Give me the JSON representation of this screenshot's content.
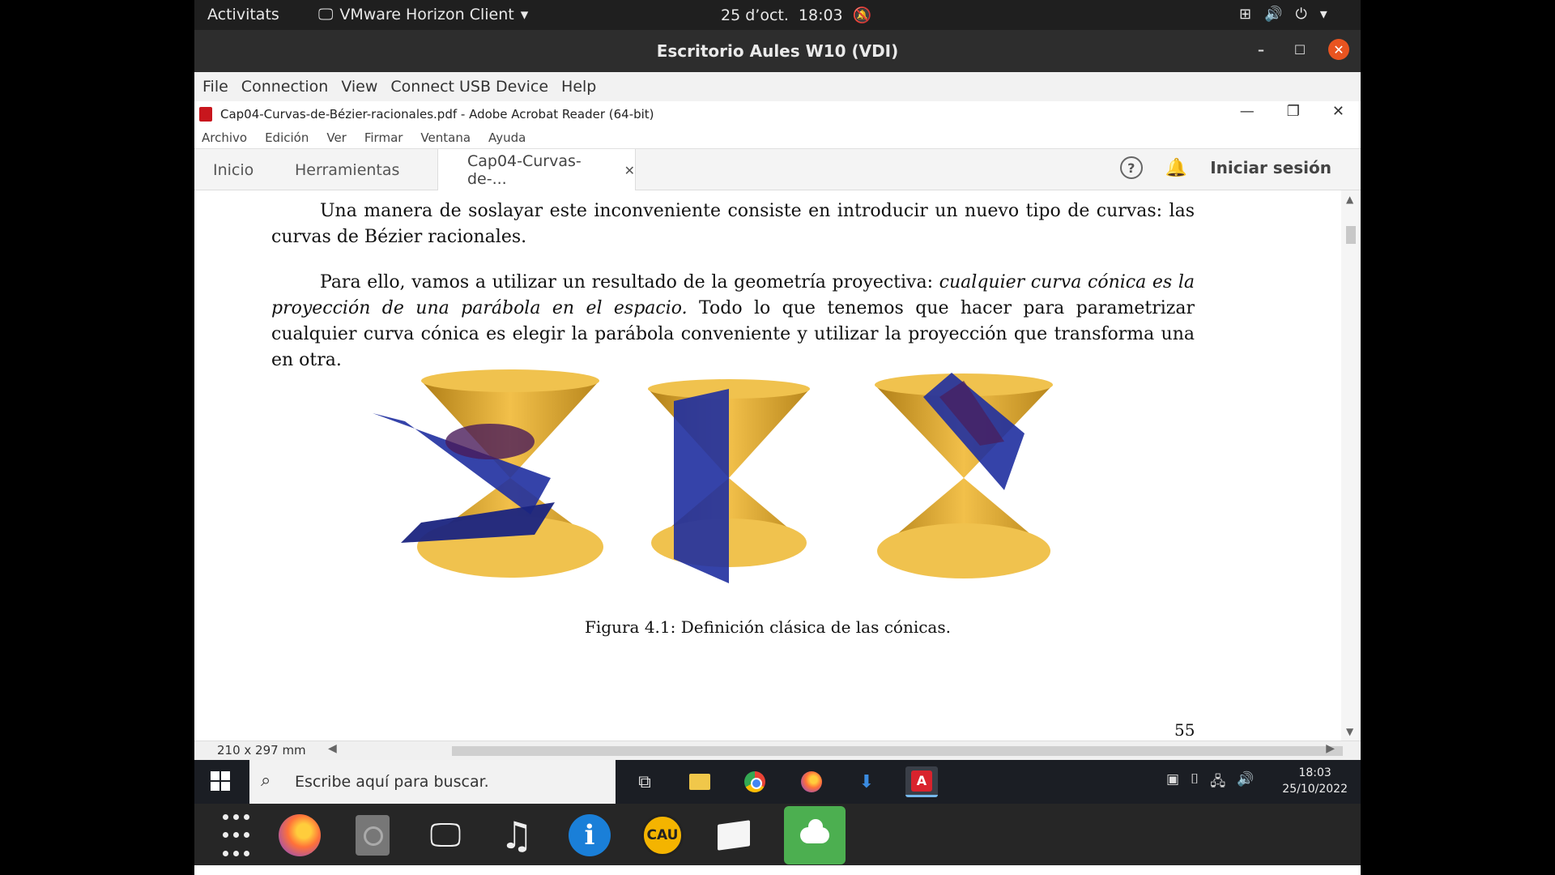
{
  "gnome": {
    "activities": "Activitats",
    "app_name": "VMware Horizon Client",
    "date": "25 d’oct.",
    "time": "18:03"
  },
  "horizon": {
    "title": "Escritorio Aules W10 (VDI)",
    "menu": [
      "File",
      "Connection",
      "View",
      "Connect USB Device",
      "Help"
    ]
  },
  "acrobat": {
    "title": "Cap04-Curvas-de-Bézier-racionales.pdf - Adobe Acrobat Reader (64-bit)",
    "menu": [
      "Archivo",
      "Edición",
      "Ver",
      "Firmar",
      "Ventana",
      "Ayuda"
    ],
    "tabs": {
      "home": "Inicio",
      "tools": "Herramientas",
      "document": "Cap04-Curvas-de-..."
    },
    "help": "?",
    "sign_in": "Iniciar sesión",
    "page_size": "210 x 297 mm"
  },
  "document": {
    "para1": "Una manera de soslayar este inconveniente consiste en introducir un nuevo tipo de curvas: las curvas de Bézier racionales.",
    "para2_start": "Para ello, vamos a utilizar un resultado de la geometría proyectiva:",
    "para2_italic": "cualquier curva cónica es la proyección de una parábola en el espacio.",
    "para2_end": "Todo lo que tenemos que hacer para parametrizar cualquier curva cónica es elegir la parábola conveniente y utilizar la proyección que transforma una en otra.",
    "caption": "Figura 4.1: Definición clásica de las cónicas.",
    "page_number": "55"
  },
  "windows": {
    "search_placeholder": "Escribe aquí para buscar.",
    "clock_time": "18:03",
    "clock_date": "25/10/2022"
  },
  "dock": {
    "cau_label": "CAU"
  },
  "colors": {
    "cone": "#e8b032",
    "plane": "#1f2fa0",
    "accent_close": "#e95420"
  }
}
